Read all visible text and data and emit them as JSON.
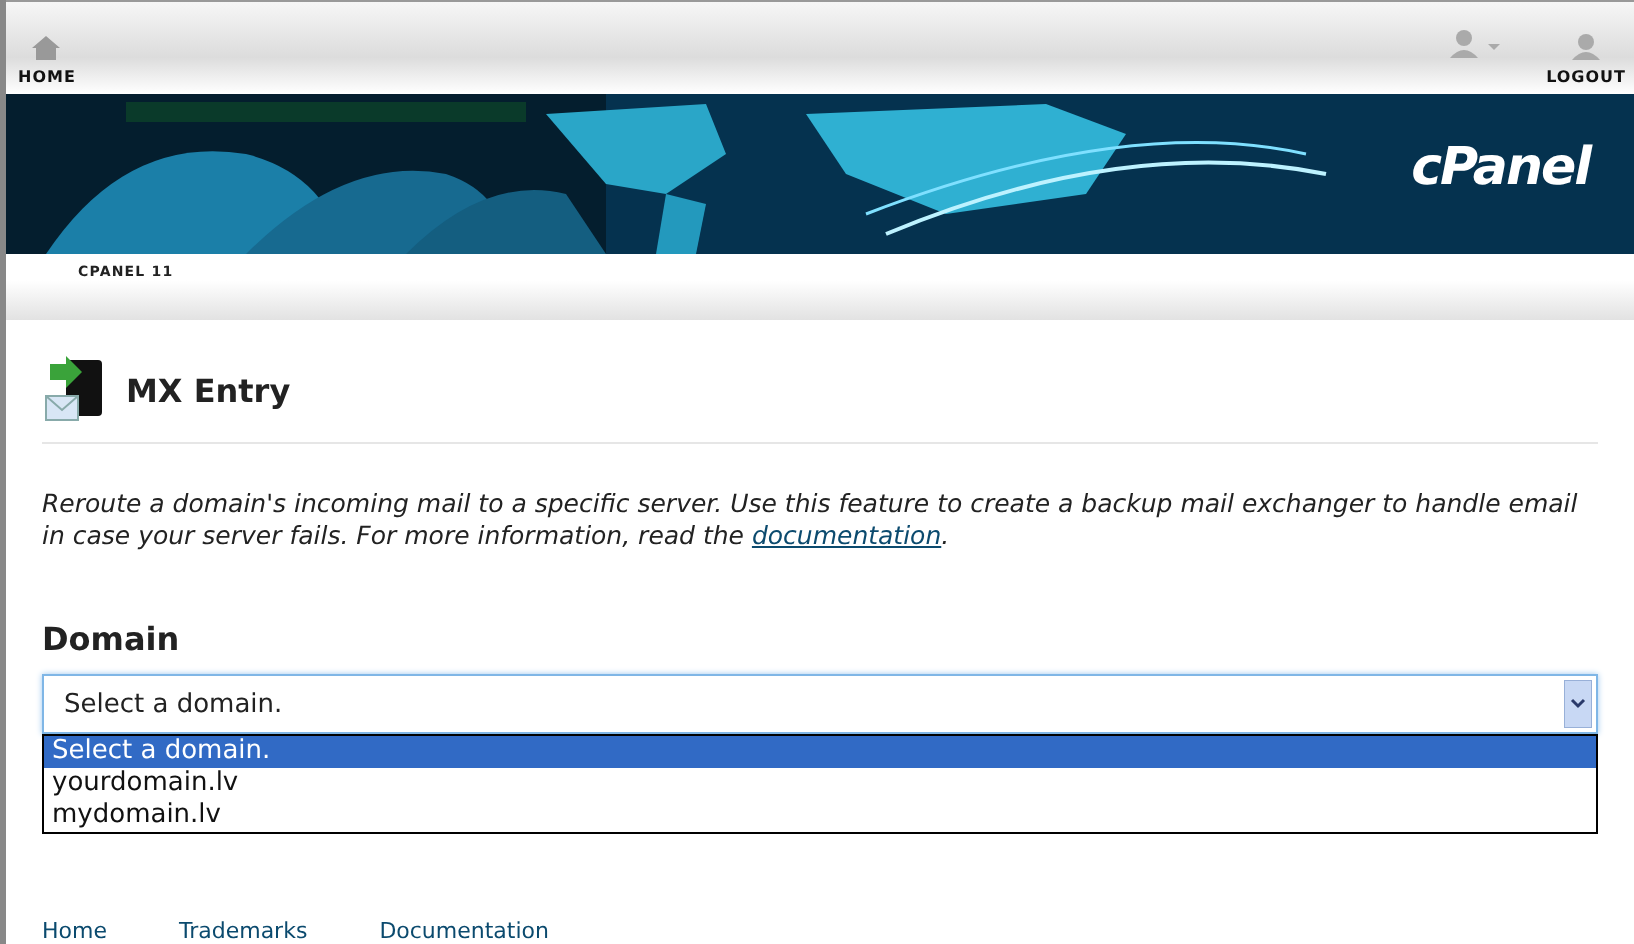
{
  "top_bar": {
    "home": "HOME",
    "logout": "LOGOUT"
  },
  "banner": {
    "logo": "cPanel",
    "kind": "picture"
  },
  "version_label": "CPANEL 11",
  "page": {
    "title": "MX Entry",
    "description": "Reroute a domain's incoming mail to a specific server. Use this feature to create a backup mail exchanger to handle email in case your server fails. For more information, read the ",
    "link": "documentation",
    "after_link": "."
  },
  "domain": {
    "label": "Domain",
    "value": "Select a domain.",
    "expanded": true,
    "options": [
      {
        "label": "Select a domain.",
        "selected": true
      },
      {
        "label": "yourdomain.lv",
        "selected": false
      },
      {
        "label": "mydomain.lv",
        "selected": false
      }
    ]
  },
  "footer_links": [
    "Home",
    "Trademarks",
    "Documentation"
  ]
}
